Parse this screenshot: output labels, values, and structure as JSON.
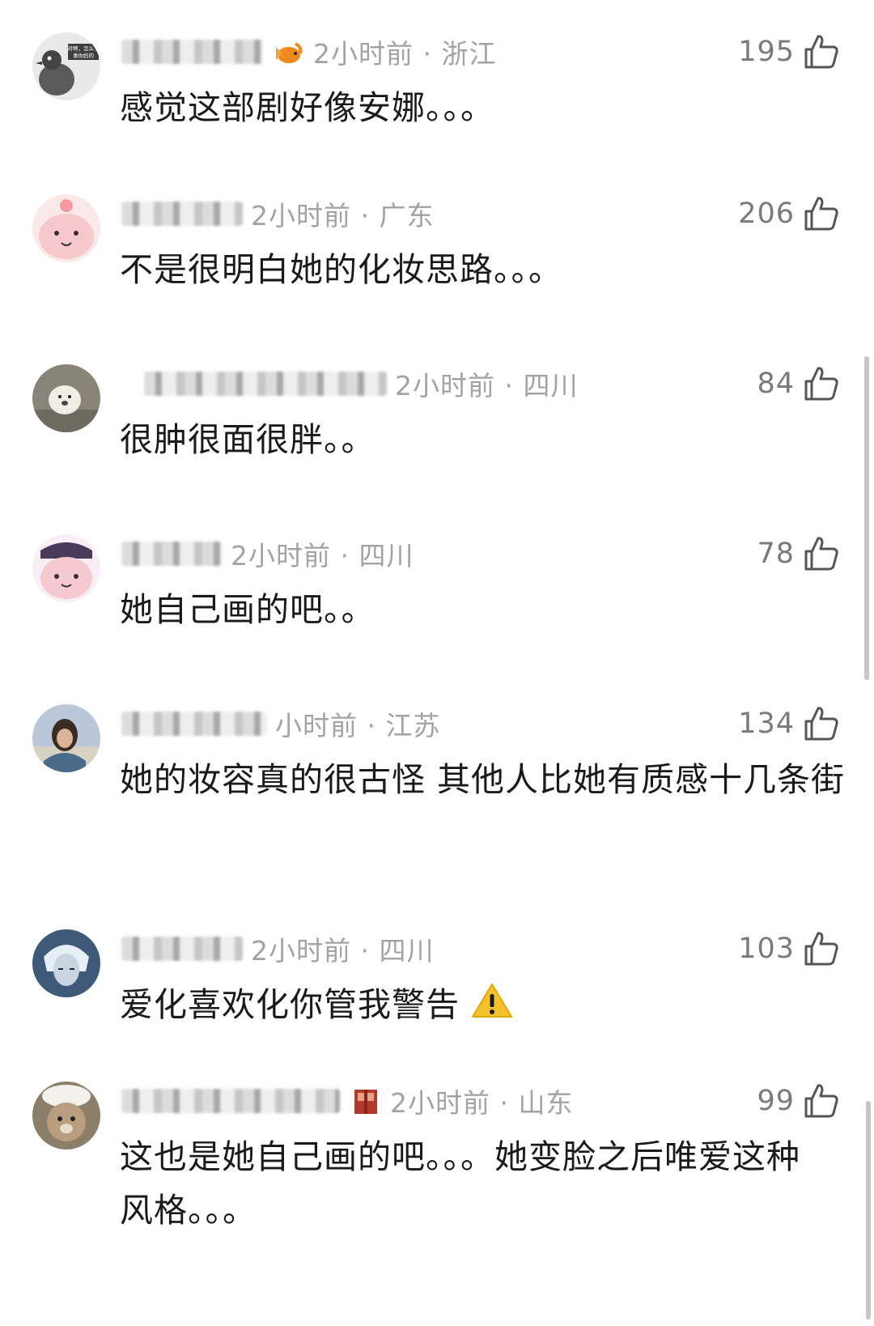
{
  "comments": [
    {
      "time_location": "2小时前 · 浙江",
      "likes": "195",
      "text": "感觉这部剧好像安娜。。。",
      "avatar_icon": "pigeon-avatar-icon",
      "badge_icon": "goldfish-badge-icon",
      "avatar_caption": "对啊，怎么了 事你妈的"
    },
    {
      "time_location": "2小时前 · 广东",
      "likes": "206",
      "text": "不是很明白她的化妆思路。。。",
      "avatar_icon": "pink-cartoon-avatar-icon"
    },
    {
      "time_location": "2小时前 · 四川",
      "likes": "84",
      "text": "很肿很面很胖。。",
      "avatar_icon": "puppy-avatar-icon"
    },
    {
      "time_location": "2小时前 · 四川",
      "likes": "78",
      "text": "她自己画的吧。。",
      "avatar_icon": "pink-cartoon-avatar-icon"
    },
    {
      "time_location": "小时前 · 江苏",
      "likes": "134",
      "text": "她的妆容真的很古怪 其他人比她有质感十几条街",
      "avatar_icon": "person-photo-avatar-icon"
    },
    {
      "time_location": "2小时前 · 四川",
      "likes": "103",
      "text": "爱化喜欢化你管我警告",
      "avatar_icon": "anime-avatar-icon",
      "trailing_icon": "warning-icon"
    },
    {
      "time_location": "2小时前 · 山东",
      "likes": "99",
      "text": "这也是她自己画的吧。。。她变脸之后唯爱这种风格。。。",
      "avatar_icon": "bear-plush-avatar-icon",
      "badge_icon": "red-gift-badge-icon"
    }
  ],
  "colors": {
    "meta_text": "#a3a3a3",
    "like_count": "#7a7a7a",
    "body_text": "#1a1a1a",
    "warning_yellow": "#f6c22b"
  }
}
